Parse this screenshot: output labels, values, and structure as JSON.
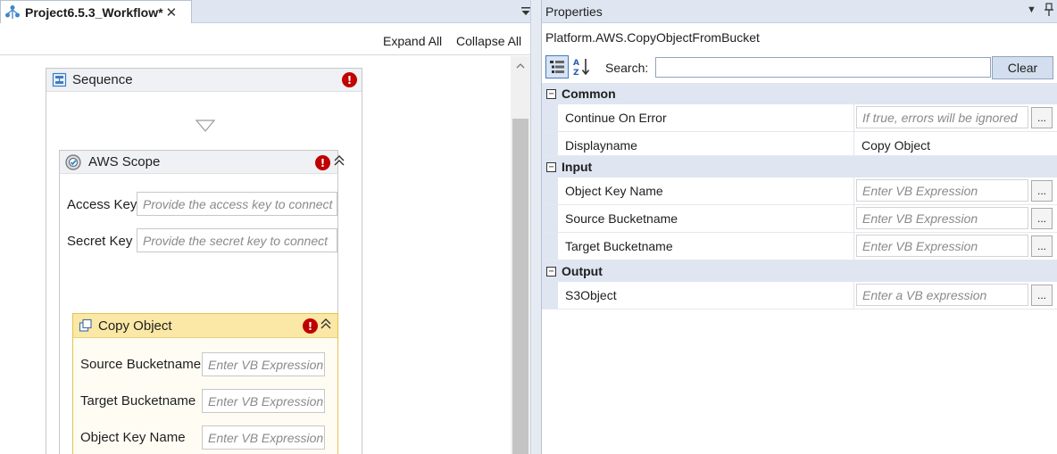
{
  "designer": {
    "tab_title": "Project6.5.3_Workflow*",
    "tab_close": "✕",
    "expand_all": "Expand All",
    "collapse_all": "Collapse All",
    "sequence": {
      "title": "Sequence",
      "error_glyph": "!"
    },
    "aws_scope": {
      "title": "AWS Scope",
      "error_glyph": "!",
      "collapse_glyph": "⌃",
      "fields": {
        "access_key_label": "Access Key",
        "access_key_placeholder": "Provide the access key to connect",
        "secret_key_label": "Secret Key",
        "secret_key_placeholder": "Provide the secret key to connect"
      }
    },
    "copy_object": {
      "title": "Copy Object",
      "error_glyph": "!",
      "fields": {
        "source_label": "Source Bucketname",
        "source_placeholder": "Enter VB Expression",
        "target_label": "Target Bucketname",
        "target_placeholder": "Enter VB Expression",
        "key_label": "Object Key Name",
        "key_placeholder": "Enter VB Expression"
      }
    }
  },
  "properties": {
    "panel_title": "Properties",
    "activity_type": "Platform.AWS.CopyObjectFromBucket",
    "search_label": "Search:",
    "search_value": "",
    "clear_label": "Clear",
    "ellipsis": "...",
    "categories": [
      {
        "name": "Common",
        "toggle": "−",
        "rows": [
          {
            "name": "Continue On Error",
            "value": "If true, errors will be ignored",
            "placeholder": true,
            "has_button": true
          },
          {
            "name": "Displayname",
            "value": "Copy Object",
            "placeholder": false,
            "has_button": false
          }
        ]
      },
      {
        "name": "Input",
        "toggle": "−",
        "rows": [
          {
            "name": "Object Key Name",
            "value": "Enter VB Expression",
            "placeholder": true,
            "has_button": true
          },
          {
            "name": "Source Bucketname",
            "value": "Enter VB Expression",
            "placeholder": true,
            "has_button": true
          },
          {
            "name": "Target Bucketname",
            "value": "Enter VB Expression",
            "placeholder": true,
            "has_button": true
          }
        ]
      },
      {
        "name": "Output",
        "toggle": "−",
        "rows": [
          {
            "name": "S3Object",
            "value": "Enter a VB expression",
            "placeholder": true,
            "has_button": true
          }
        ]
      }
    ]
  },
  "colors": {
    "error_red": "#c00000",
    "copy_object_header": "#fbe8a6",
    "panel_header": "#dfe6f1"
  }
}
